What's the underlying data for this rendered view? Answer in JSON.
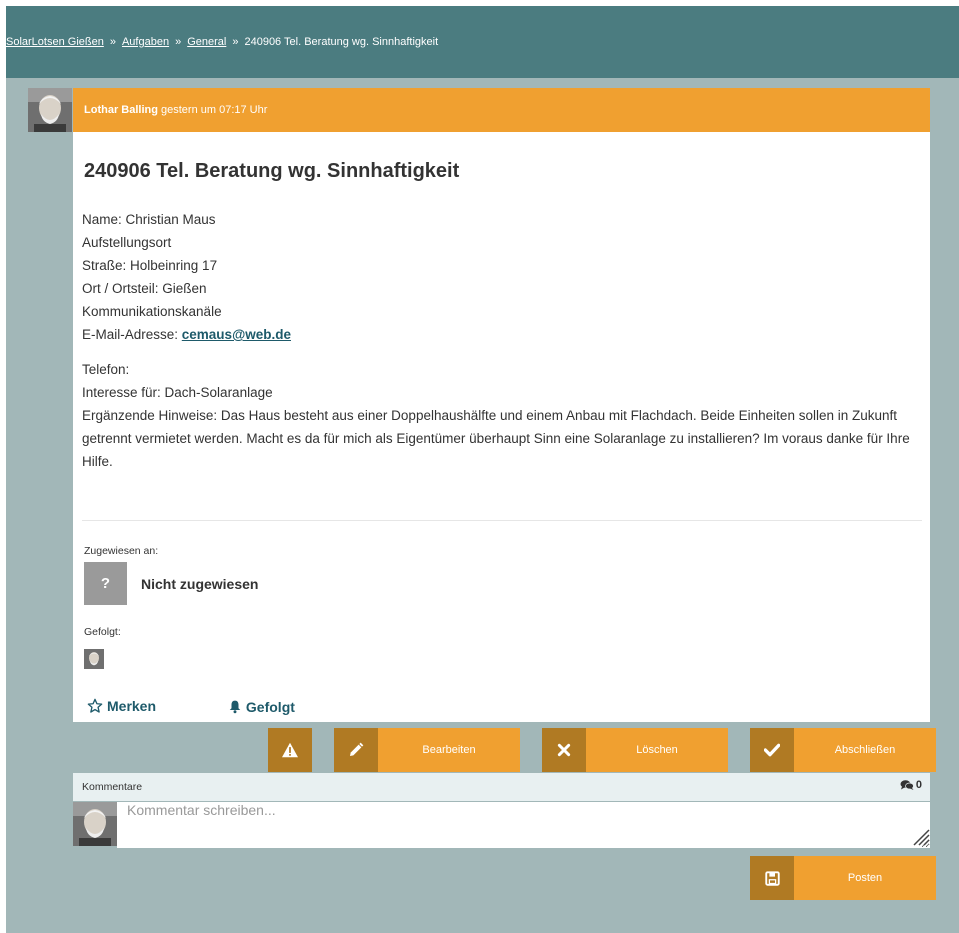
{
  "breadcrumb": {
    "items": [
      "SolarLotsen Gießen",
      "Aufgaben",
      "General"
    ],
    "current": "240906 Tel. Beratung wg. Sinnhaftigkeit",
    "separator": "»"
  },
  "post": {
    "author": "Lothar Balling",
    "time": "gestern um 07:17 Uhr",
    "title": "240906 Tel. Beratung wg. Sinnhaftigkeit",
    "lines1": [
      "Name: Christian Maus",
      "Aufstellungsort",
      "Straße: Holbeinring 17",
      "Ort / Ortsteil: Gießen",
      "Kommunikationskanäle"
    ],
    "email_label": "E-Mail-Adresse: ",
    "email": "cemaus@web.de",
    "lines2": [
      "Telefon:",
      "Interesse für: Dach-Solaranlage"
    ],
    "hint": "Ergänzende Hinweise: Das Haus besteht aus einer Doppelhaushälfte und einem Anbau mit Flachdach. Beide Einheiten sollen in Zukunft getrennt vermietet werden. Macht es da für mich als Eigentümer überhaupt Sinn eine Solaranlage zu installieren? Im voraus danke für Ihre Hilfe."
  },
  "assigned": {
    "label": "Zugewiesen an:",
    "mark": "?",
    "value": "Nicht zugewiesen"
  },
  "followed": {
    "label": "Gefolgt:"
  },
  "links": {
    "bookmark": "Merken",
    "follow": "Gefolgt"
  },
  "buttons": {
    "edit": "Bearbeiten",
    "delete": "Löschen",
    "close": "Abschließen",
    "post": "Posten"
  },
  "comments": {
    "label": "Kommentare",
    "count": "0",
    "placeholder": "Kommentar schreiben..."
  },
  "colors": {
    "header_bg": "#4b7c80",
    "page_bg": "#a2b7b8",
    "accent": "#f0a030",
    "accent_dark": "#b07a23",
    "link": "#1e5a6a"
  }
}
